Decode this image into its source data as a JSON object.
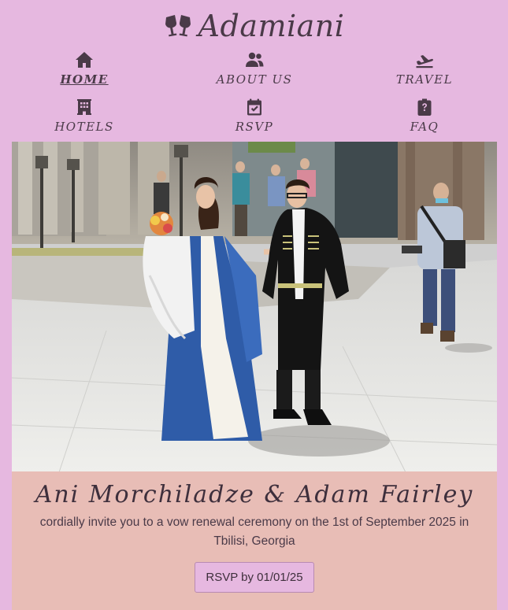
{
  "brand": {
    "name": "Adamiani",
    "icon": "wine-glasses-icon"
  },
  "nav": {
    "items": [
      {
        "label": "HOME",
        "icon": "home-icon",
        "active": true
      },
      {
        "label": "ABOUT US",
        "icon": "users-icon",
        "active": false
      },
      {
        "label": "TRAVEL",
        "icon": "plane-departure-icon",
        "active": false
      },
      {
        "label": "HOTELS",
        "icon": "hotel-icon",
        "active": false
      },
      {
        "label": "RSVP",
        "icon": "calendar-check-icon",
        "active": false
      },
      {
        "label": "FAQ",
        "icon": "clipboard-question-icon",
        "active": false
      }
    ]
  },
  "hero": {
    "image": "couple-photo"
  },
  "invitation": {
    "couple": "Ani Morchiladze & Adam Fairley",
    "text": "cordially invite you to a vow renewal ceremony on the 1st of September 2025 in Tbilisi, Georgia",
    "rsvp_button": "RSVP by 01/01/25"
  },
  "colors": {
    "page_background": "#e6b8e0",
    "info_background": "#e8bdb6",
    "text": "#4a3a48"
  }
}
